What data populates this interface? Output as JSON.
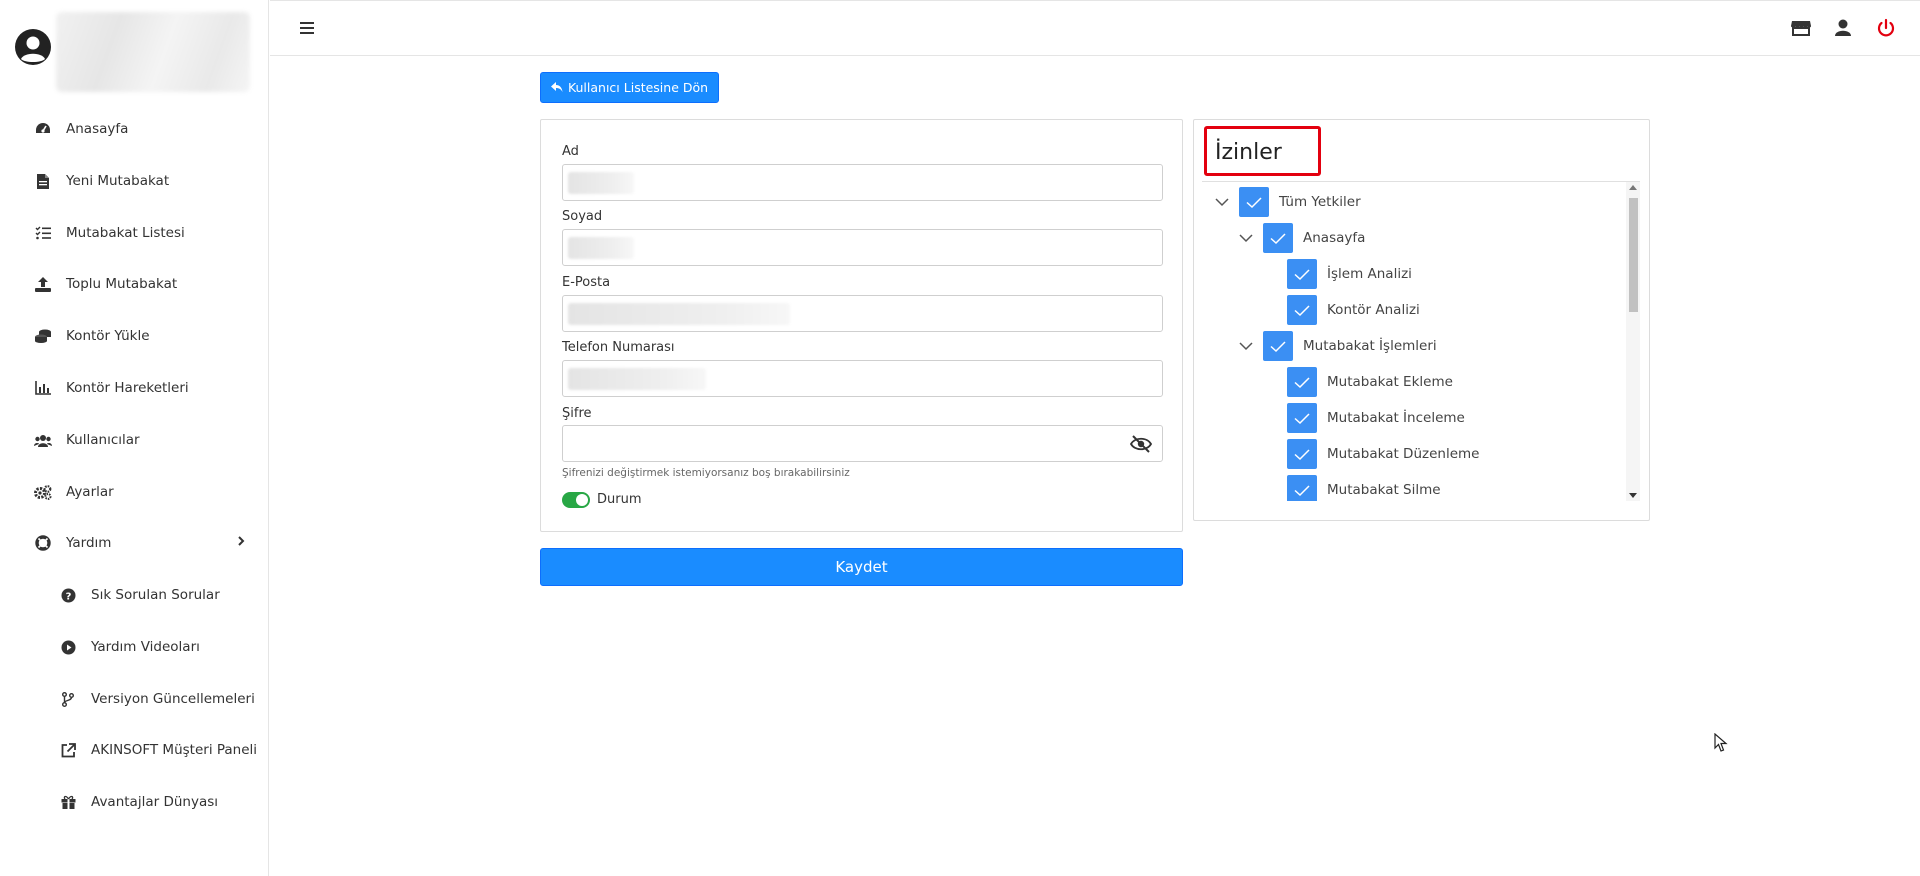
{
  "sidebar": {
    "items": [
      {
        "label": "Anasayfa",
        "icon": "dashboard-icon"
      },
      {
        "label": "Yeni Mutabakat",
        "icon": "file-icon"
      },
      {
        "label": "Mutabakat Listesi",
        "icon": "list-check-icon"
      },
      {
        "label": "Toplu Mutabakat",
        "icon": "upload-icon"
      },
      {
        "label": "Kontör Yükle",
        "icon": "coins-icon"
      },
      {
        "label": "Kontör Hareketleri",
        "icon": "chart-bar-icon"
      },
      {
        "label": "Kullanıcılar",
        "icon": "users-icon"
      },
      {
        "label": "Ayarlar",
        "icon": "gears-icon"
      },
      {
        "label": "Yardım",
        "icon": "life-ring-icon"
      }
    ],
    "subitems": [
      {
        "label": "Sık Sorulan Sorular",
        "icon": "question-circle-icon"
      },
      {
        "label": "Yardım Videoları",
        "icon": "play-circle-icon"
      },
      {
        "label": "Versiyon Güncellemeleri",
        "icon": "code-branch-icon"
      },
      {
        "label": "AKINSOFT Müşteri Paneli",
        "icon": "external-link-icon"
      },
      {
        "label": "Avantajlar Dünyası",
        "icon": "gift-icon"
      }
    ]
  },
  "topbar": {
    "icons": [
      "menu-icon",
      "store-icon",
      "user-icon",
      "power-icon"
    ]
  },
  "back_button": {
    "label": "Kullanıcı Listesine Dön"
  },
  "form": {
    "first_name_label": "Ad",
    "last_name_label": "Soyad",
    "email_label": "E-Posta",
    "phone_label": "Telefon Numarası",
    "password_label": "Şifre",
    "password_hint": "Şifrenizi değiştirmek istemiyorsanız boş bırakabilirsiniz",
    "status_label": "Durum",
    "status_enabled": true
  },
  "save_button": {
    "label": "Kaydet"
  },
  "permissions": {
    "title": "İzinler",
    "tree": [
      {
        "label": "Tüm Yetkiler",
        "checked": true,
        "expanded": true,
        "level": 0
      },
      {
        "label": "Anasayfa",
        "checked": true,
        "expanded": true,
        "level": 1
      },
      {
        "label": "İşlem Analizi",
        "checked": true,
        "level": 2
      },
      {
        "label": "Kontör Analizi",
        "checked": true,
        "level": 2
      },
      {
        "label": "Mutabakat İşlemleri",
        "checked": true,
        "expanded": true,
        "level": 1
      },
      {
        "label": "Mutabakat Ekleme",
        "checked": true,
        "level": 2
      },
      {
        "label": "Mutabakat İnceleme",
        "checked": true,
        "level": 2
      },
      {
        "label": "Mutabakat Düzenleme",
        "checked": true,
        "level": 2
      },
      {
        "label": "Mutabakat Silme",
        "checked": true,
        "level": 2
      }
    ]
  },
  "colors": {
    "primary": "#1a8cff",
    "checkbox": "#3b8ff3",
    "toggle_on": "#28a745",
    "power": "#e3000f",
    "highlight_box": "#e3000f"
  }
}
